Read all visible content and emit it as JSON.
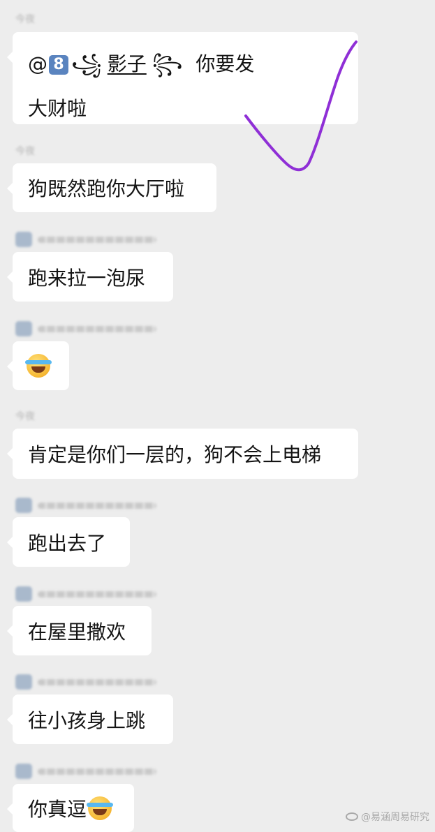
{
  "messages": [
    {
      "sender": "今夜",
      "parts": [
        "@",
        "8",
        "꧁",
        "影子",
        "꧂",
        "你要发",
        "大财啦"
      ]
    },
    {
      "sender": "今夜",
      "text": "狗既然跑你大厅啦"
    },
    {
      "sender": "小区居民某某",
      "text": "跑来拉一泡尿"
    },
    {
      "sender": "小区居民某某"
    },
    {
      "sender": "今夜",
      "text": "肯定是你们一层的，狗不会上电梯"
    },
    {
      "sender": "小区居民某某",
      "text": "跑出去了"
    },
    {
      "sender": "小区居民某某",
      "text": "在屋里撒欢"
    },
    {
      "sender": "小区居民某某",
      "text": "往小孩身上跳"
    },
    {
      "sender": "小区居民某某",
      "text": "你真逗"
    }
  ],
  "emoji": "face-with-tears-of-joy-icon",
  "watermark": {
    "handle": "@易涵周易研究"
  },
  "colors": {
    "background": "#ededed",
    "bubble": "#ffffff",
    "check_stroke": "#8f2fd6"
  }
}
